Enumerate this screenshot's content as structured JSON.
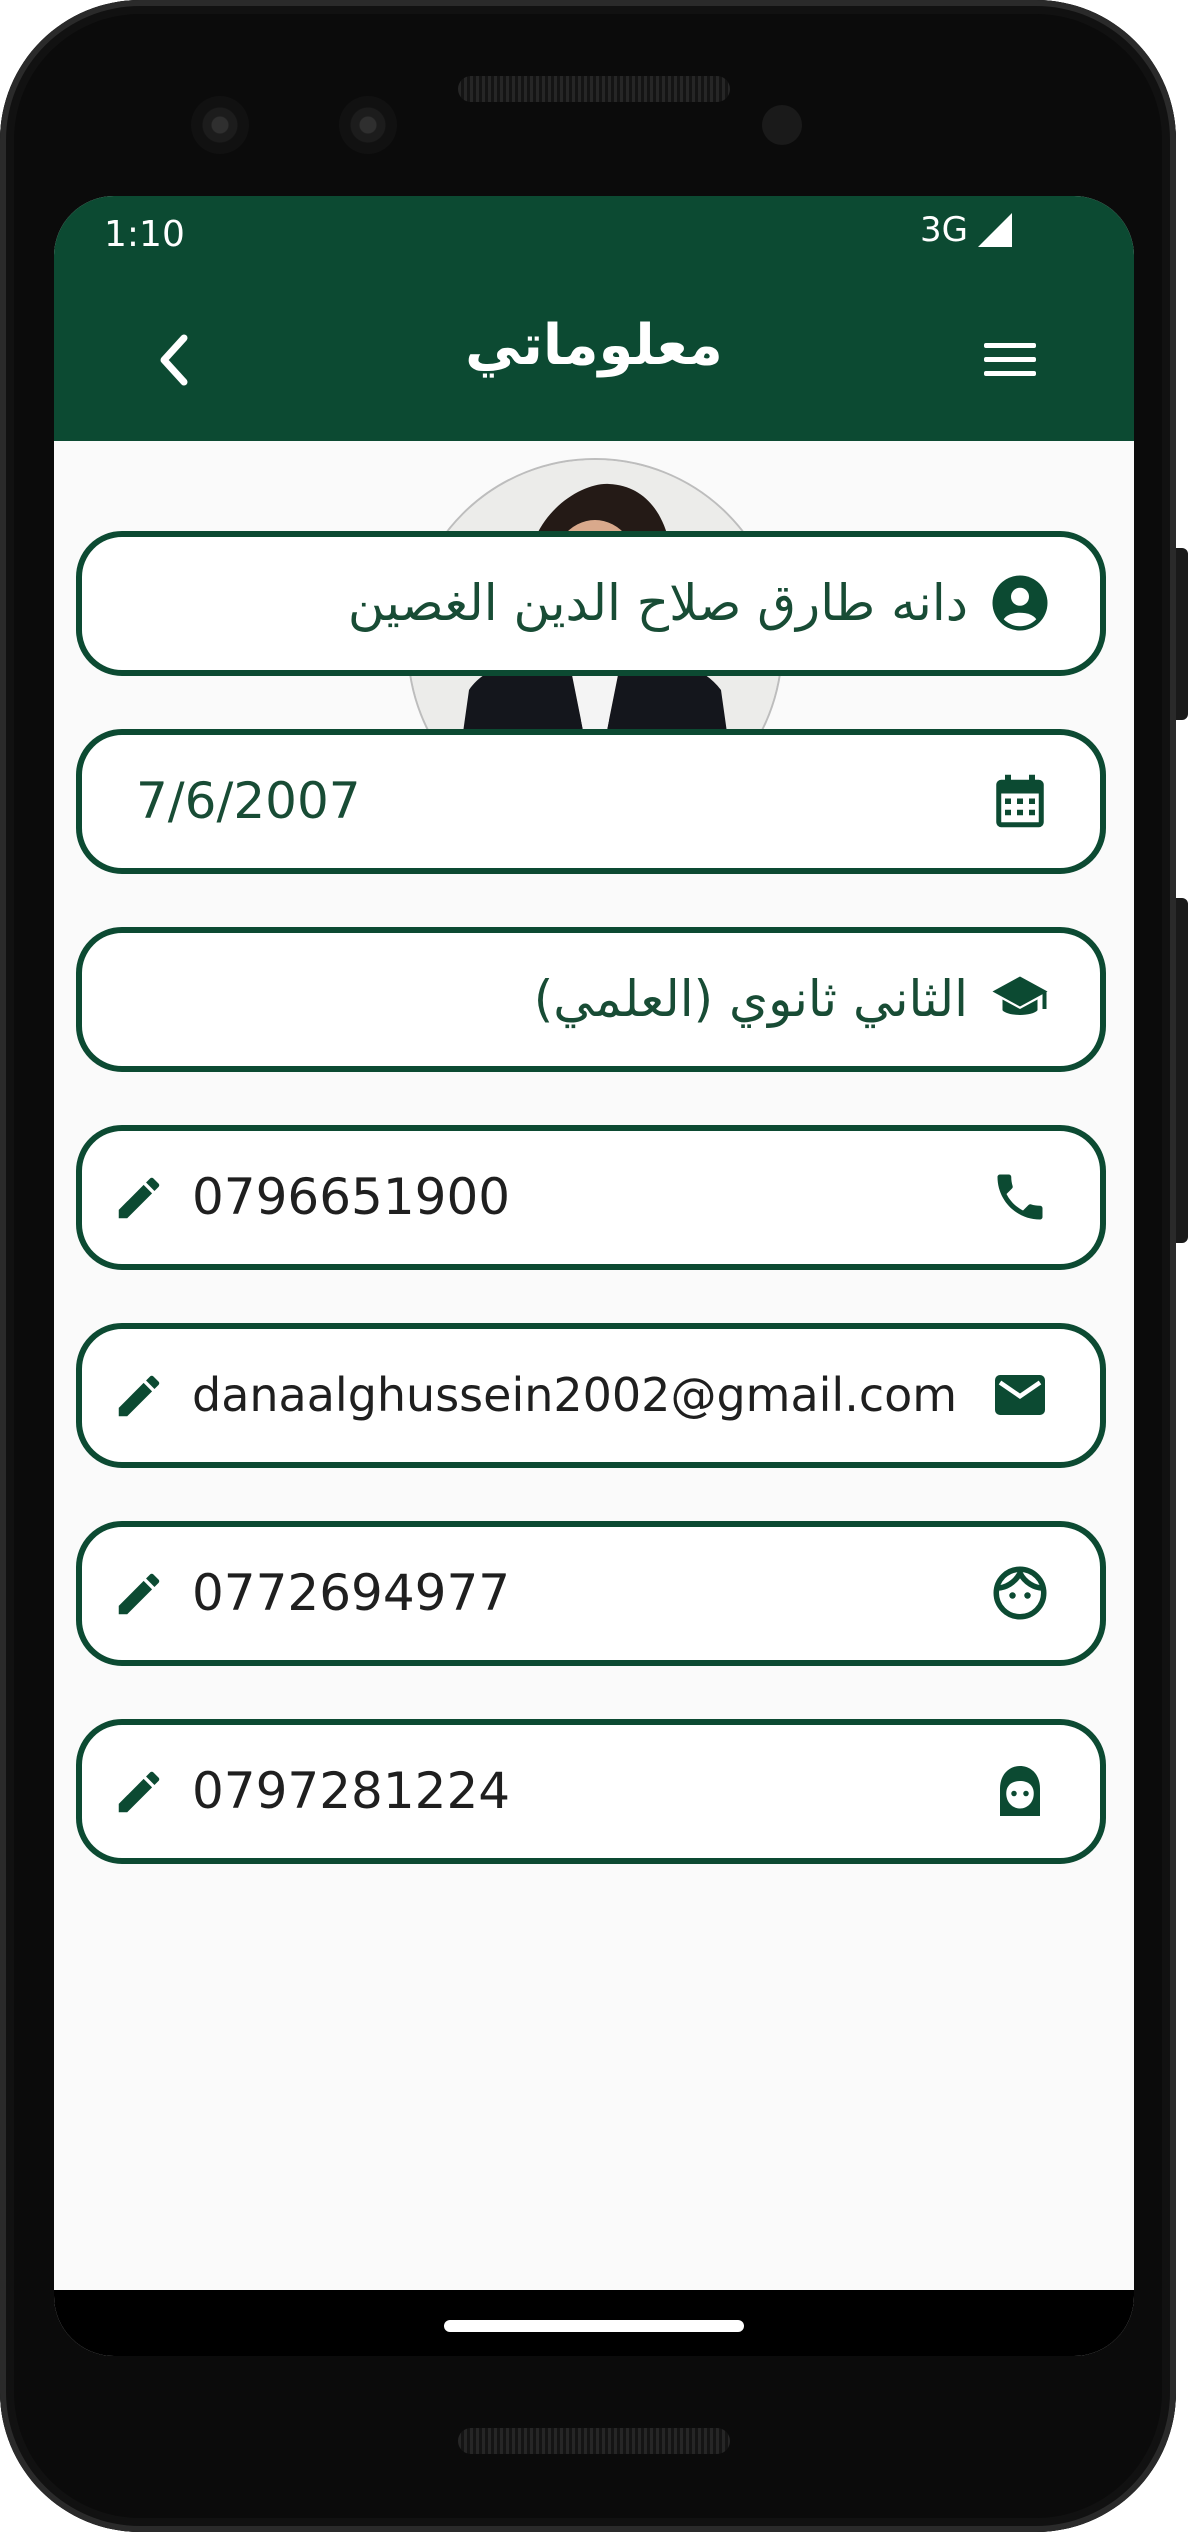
{
  "status_bar": {
    "time": "1:10",
    "network": "3G"
  },
  "header": {
    "title": "معلوماتي",
    "back_icon": "chevron-left-icon",
    "menu_icon": "hamburger-menu-icon"
  },
  "profile": {
    "photo": "profile-photo"
  },
  "fields": {
    "name": "دانه طارق صلاح الدين الغصين",
    "birthdate": "7/6/2007",
    "grade": "الثاني ثانوي (العلمي)",
    "phone": "0796651900",
    "email": "danaalghussein2002@gmail.com",
    "parent1_phone": "0772694977",
    "parent2_phone": "0797281224"
  },
  "colors": {
    "primary": "#0c4a32",
    "background": "#fafafa",
    "text": "#1f1f1f"
  }
}
